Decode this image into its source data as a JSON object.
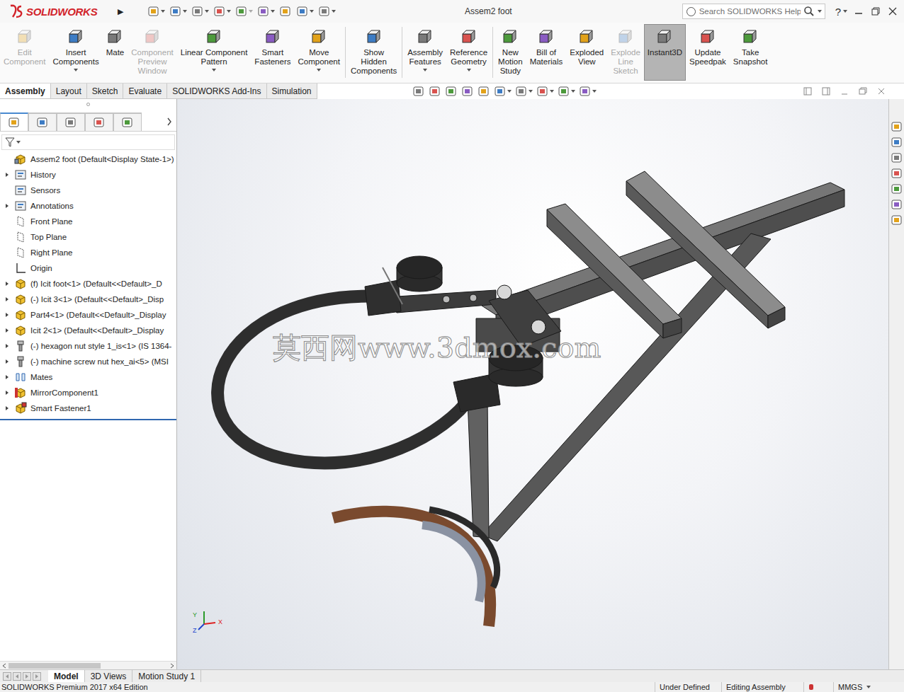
{
  "window": {
    "title": "Assem2 foot",
    "logo": "SOLIDWORKS",
    "menu_arrow": "▶"
  },
  "search": {
    "placeholder": "Search SOLIDWORKS Help"
  },
  "help": {
    "label": "?"
  },
  "ribbon": [
    {
      "label": "Edit\nComponent",
      "disabled": true,
      "selected": false,
      "dropdown": false
    },
    {
      "label": "Insert\nComponents",
      "disabled": false,
      "selected": false,
      "dropdown": true
    },
    {
      "label": "Mate",
      "disabled": false,
      "selected": false,
      "dropdown": false
    },
    {
      "label": "Component\nPreview\nWindow",
      "disabled": true,
      "selected": false,
      "dropdown": false
    },
    {
      "label": "Linear Component\nPattern",
      "disabled": false,
      "selected": false,
      "dropdown": true
    },
    {
      "label": "Smart\nFasteners",
      "disabled": false,
      "selected": false,
      "dropdown": false
    },
    {
      "label": "Move\nComponent",
      "disabled": false,
      "selected": false,
      "dropdown": true
    },
    {
      "label": "Show\nHidden\nComponents",
      "disabled": false,
      "selected": false,
      "dropdown": false
    },
    {
      "label": "Assembly\nFeatures",
      "disabled": false,
      "selected": false,
      "dropdown": true
    },
    {
      "label": "Reference\nGeometry",
      "disabled": false,
      "selected": false,
      "dropdown": true
    },
    {
      "label": "New\nMotion\nStudy",
      "disabled": false,
      "selected": false,
      "dropdown": false
    },
    {
      "label": "Bill of\nMaterials",
      "disabled": false,
      "selected": false,
      "dropdown": false
    },
    {
      "label": "Exploded\nView",
      "disabled": false,
      "selected": false,
      "dropdown": false
    },
    {
      "label": "Explode\nLine\nSketch",
      "disabled": true,
      "selected": false,
      "dropdown": false
    },
    {
      "label": "Instant3D",
      "disabled": false,
      "selected": true,
      "dropdown": false
    },
    {
      "label": "Update\nSpeedpak",
      "disabled": false,
      "selected": false,
      "dropdown": false
    },
    {
      "label": "Take\nSnapshot",
      "disabled": false,
      "selected": false,
      "dropdown": false
    }
  ],
  "command_tabs": [
    {
      "label": "Assembly",
      "selected": true
    },
    {
      "label": "Layout",
      "selected": false
    },
    {
      "label": "Sketch",
      "selected": false
    },
    {
      "label": "Evaluate",
      "selected": false
    },
    {
      "label": "SOLIDWORKS Add-Ins",
      "selected": false
    },
    {
      "label": "Simulation",
      "selected": false
    }
  ],
  "panel_tabs": [
    {
      "selected": true
    },
    {
      "selected": false
    },
    {
      "selected": false
    },
    {
      "selected": false
    },
    {
      "selected": false
    }
  ],
  "tree": {
    "items": [
      {
        "label": "Assem2 foot  (Default<Display State-1>)",
        "kind": "assembly",
        "expandable": false
      },
      {
        "label": "History",
        "kind": "history",
        "expandable": true
      },
      {
        "label": "Sensors",
        "kind": "sensors",
        "expandable": false
      },
      {
        "label": "Annotations",
        "kind": "annotations",
        "expandable": true
      },
      {
        "label": "Front Plane",
        "kind": "plane",
        "expandable": false
      },
      {
        "label": "Top Plane",
        "kind": "plane",
        "expandable": false
      },
      {
        "label": "Right Plane",
        "kind": "plane",
        "expandable": false
      },
      {
        "label": "Origin",
        "kind": "origin",
        "expandable": false
      },
      {
        "label": "(f) Icit foot<1> (Default<<Default>_D",
        "kind": "part",
        "expandable": true
      },
      {
        "label": "(-) Icit 3<1> (Default<<Default>_Disp",
        "kind": "part",
        "expandable": true
      },
      {
        "label": "Part4<1> (Default<<Default>_Display",
        "kind": "part",
        "expandable": true
      },
      {
        "label": "Icit 2<1> (Default<<Default>_Display",
        "kind": "part",
        "expandable": true
      },
      {
        "label": "(-) hexagon nut style 1_is<1> (IS 1364-",
        "kind": "fastener",
        "expandable": true
      },
      {
        "label": "(-) machine screw nut hex_ai<5> (MSI",
        "kind": "fastener",
        "expandable": true
      },
      {
        "label": "Mates",
        "kind": "mates",
        "expandable": true
      },
      {
        "label": "MirrorComponent1",
        "kind": "mirror",
        "expandable": true
      },
      {
        "label": "Smart Fastener1",
        "kind": "smart-fastener",
        "expandable": true
      }
    ]
  },
  "viewport": {
    "watermark": "莫西网www.3dmox.com",
    "axes": [
      "Y",
      "Z",
      "X"
    ]
  },
  "bottom_tabs": [
    {
      "label": "Model",
      "selected": true
    },
    {
      "label": "3D Views",
      "selected": false
    },
    {
      "label": "Motion Study 1",
      "selected": false
    }
  ],
  "status_bar": {
    "edition": "SOLIDWORKS Premium 2017 x64 Edition",
    "state": "Under Defined",
    "mode": "Editing Assembly",
    "units": "MMGS"
  }
}
